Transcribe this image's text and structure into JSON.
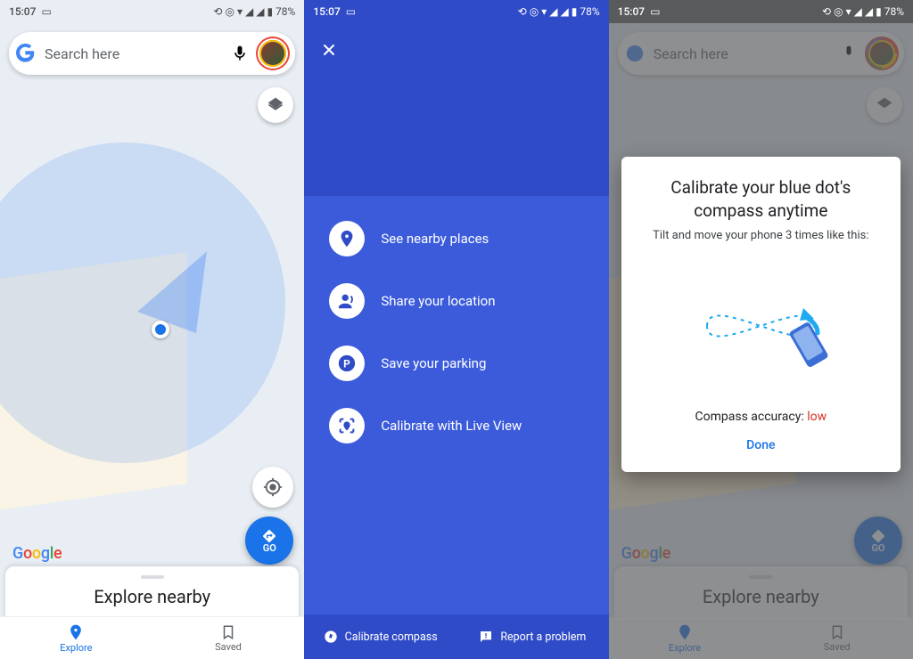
{
  "statusbar": {
    "time": "15:07",
    "battery": "78%"
  },
  "search": {
    "placeholder": "Search here"
  },
  "go_label": "GO",
  "sheet_title": "Explore nearby",
  "nav": {
    "explore": "Explore",
    "saved": "Saved"
  },
  "google_watermark": [
    "G",
    "o",
    "o",
    "g",
    "l",
    "e"
  ],
  "bluedot_actions": {
    "see_nearby": "See nearby places",
    "share_location": "Share your location",
    "save_parking": "Save your parking",
    "calibrate_liveview": "Calibrate with Live View"
  },
  "bluedot_footer": {
    "calibrate": "Calibrate compass",
    "report": "Report a problem"
  },
  "calibrate_modal": {
    "title_line1": "Calibrate your blue dot's",
    "title_line2": "compass anytime",
    "subtitle": "Tilt and move your phone 3 times like this:",
    "accuracy_label": "Compass accuracy: ",
    "accuracy_value": "low",
    "done": "Done"
  }
}
